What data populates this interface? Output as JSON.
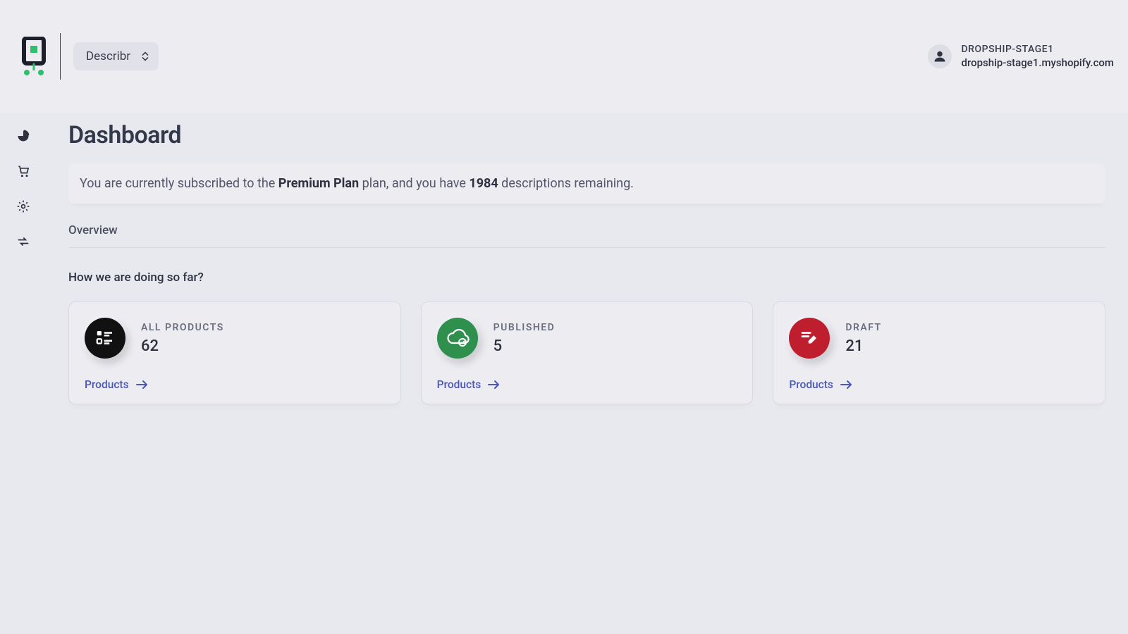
{
  "header": {
    "app_selector": "Describr",
    "account": {
      "name": "DROPSHIP-STAGE1",
      "domain": "dropship-stage1.myshopify.com"
    }
  },
  "sidebar": {
    "items": [
      {
        "name": "dashboard-icon"
      },
      {
        "name": "cart-icon"
      },
      {
        "name": "settings-icon"
      },
      {
        "name": "sync-icon"
      }
    ]
  },
  "page": {
    "title": "Dashboard",
    "banner": {
      "prefix": "You are currently subscribed to the ",
      "plan": "Premium Plan",
      "mid": " plan, and you have ",
      "count": "1984",
      "suffix": " descriptions remaining."
    },
    "section_label": "Overview",
    "subheading": "How we are doing so far?",
    "cards": [
      {
        "label": "ALL PRODUCTS",
        "value": "62",
        "link": "Products",
        "icon": "grid-list-icon",
        "color": "black"
      },
      {
        "label": "PUBLISHED",
        "value": "5",
        "link": "Products",
        "icon": "cloud-check-icon",
        "color": "green"
      },
      {
        "label": "DRAFT",
        "value": "21",
        "link": "Products",
        "icon": "pen-icon",
        "color": "red"
      }
    ]
  }
}
